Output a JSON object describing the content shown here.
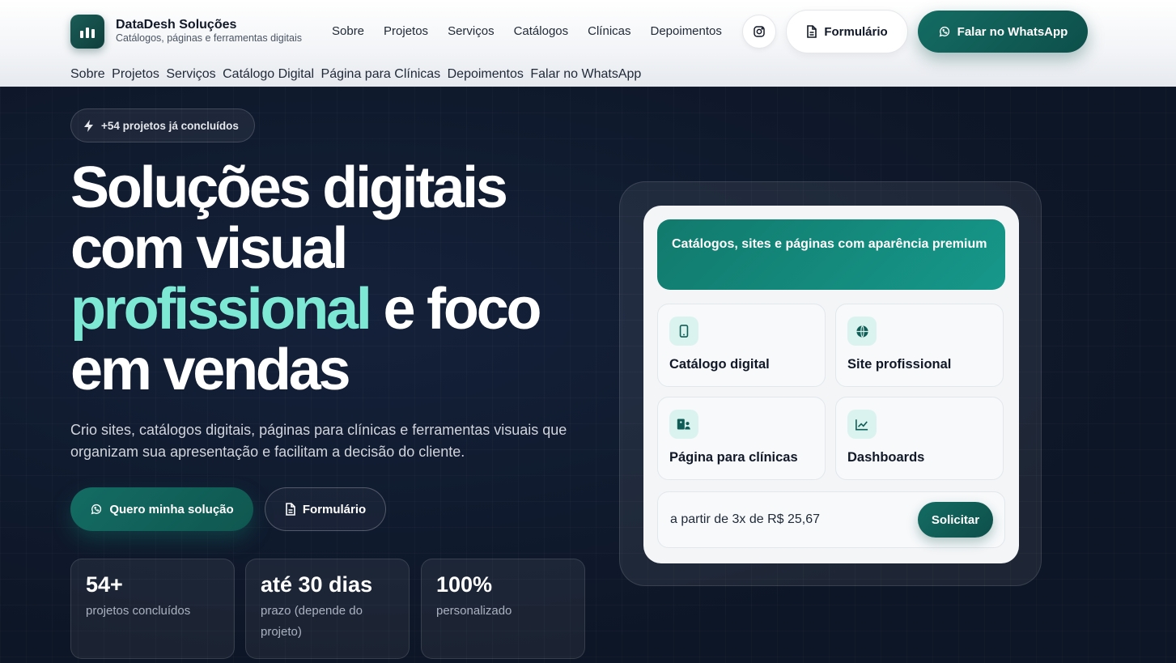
{
  "header": {
    "brand_name": "DataDesh Soluções",
    "brand_tagline": "Catálogos, páginas e ferramentas digitais",
    "nav": [
      "Sobre",
      "Projetos",
      "Serviços",
      "Catálogos",
      "Clínicas",
      "Depoimentos"
    ],
    "instagram_icon": "instagram-icon",
    "form_button": "Formulário",
    "whatsapp_button": "Falar no WhatsApp",
    "subnav": [
      "Sobre",
      "Projetos",
      "Serviços",
      "Catálogo Digital",
      "Página para Clínicas",
      "Depoimentos",
      "Falar no WhatsApp"
    ]
  },
  "hero": {
    "badge": "+54 projetos já concluídos",
    "headline_1": "Soluções digitais",
    "headline_2": "com visual",
    "headline_accent": "profissional",
    "headline_3": "e foco",
    "headline_4": "em vendas",
    "lead": "Crio sites, catálogos digitais, páginas para clínicas e ferramentas visuais que organizam sua apresentação e facilitam a decisão do cliente.",
    "primary_button": "Quero minha solução",
    "secondary_button": "Formulário",
    "stats": [
      {
        "value": "54+",
        "label": "projetos concluídos"
      },
      {
        "value": "até 30 dias",
        "label": "prazo (depende do projeto)"
      },
      {
        "value": "100%",
        "label": "personalizado"
      }
    ]
  },
  "card": {
    "title": "Catálogos, sites e páginas com aparência premium",
    "tiles": [
      {
        "icon": "smartphone-icon",
        "label": "Catálogo digital"
      },
      {
        "icon": "globe-icon",
        "label": "Site profissional"
      },
      {
        "icon": "clinic-icon",
        "label": "Página para clínicas"
      },
      {
        "icon": "chart-line-icon",
        "label": "Dashboards"
      }
    ],
    "price": "a partir de 3x de R$ 25,67",
    "cta": "Solicitar"
  },
  "colors": {
    "brand_dark": "#0e4f4a",
    "accent_teal": "#16988a",
    "headline_accent": "#7de8d4",
    "hero_bg": "#0d1626"
  }
}
